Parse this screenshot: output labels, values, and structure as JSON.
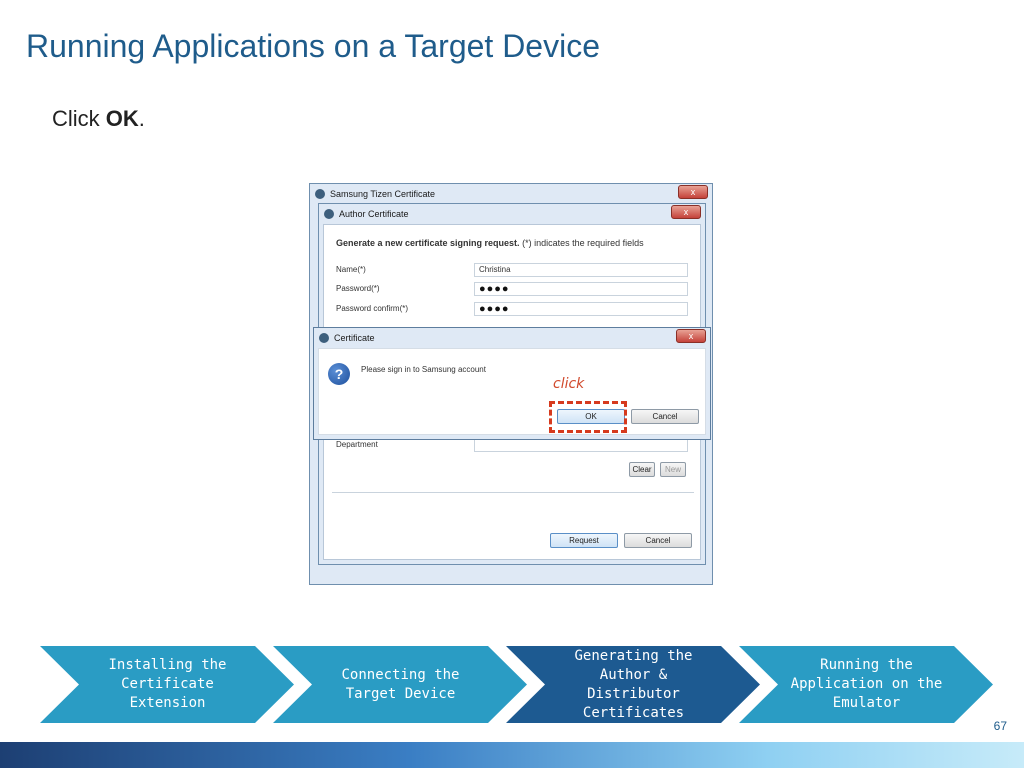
{
  "slide": {
    "title": "Running Applications on a Target Device",
    "instruction_prefix": "Click ",
    "instruction_bold": "OK",
    "instruction_suffix": ".",
    "page_number": "67"
  },
  "outer_window": {
    "title": "Samsung Tizen Certificate",
    "close": "x"
  },
  "author_window": {
    "title": "Author Certificate",
    "close": "x",
    "heading_bold": "Generate a new certificate signing request.",
    "heading_note": "(*) indicates the required fields",
    "fields": [
      {
        "label": "Name(*)",
        "value": "Christina"
      },
      {
        "label": "Password(*)",
        "value": "●●●●"
      },
      {
        "label": "Password confirm(*)",
        "value": "●●●●"
      }
    ],
    "department_label": "Department",
    "clear_label": "Clear",
    "new_label": "New",
    "request_label": "Request",
    "cancel_label": "Cancel"
  },
  "cert_dialog": {
    "title": "Certificate",
    "close": "x",
    "icon": "?",
    "message": "Please sign in to Samsung account",
    "ok_label": "OK",
    "cancel_label": "Cancel"
  },
  "annotation": {
    "click_label": "click",
    "color": "#d63a1e"
  },
  "process_steps": [
    {
      "label": "Installing the\nCertificate\nExtension",
      "color": "#2a9cc4",
      "active": false
    },
    {
      "label": "Connecting the\nTarget Device",
      "color": "#2a9cc4",
      "active": false
    },
    {
      "label": "Generating the\nAuthor &\nDistributor\nCertificates",
      "color": "#1d5a91",
      "active": true
    },
    {
      "label": "Running the\nApplication on the\nEmulator",
      "color": "#2a9cc4",
      "active": false
    }
  ]
}
